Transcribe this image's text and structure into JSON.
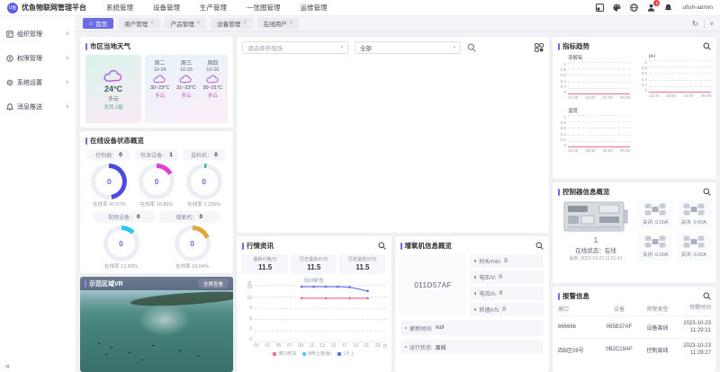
{
  "navbar": {
    "logo_text": "U鱼",
    "title": "优鱼物联网管理平台",
    "menu": [
      {
        "label": "系统管理"
      },
      {
        "label": "设备管理"
      },
      {
        "label": "生产管理"
      },
      {
        "label": "一张图管理"
      },
      {
        "label": "运维管理"
      }
    ],
    "badge_count": "6",
    "username": "ufish-admin"
  },
  "tabbar": {
    "tabs": [
      {
        "label": "首页"
      },
      {
        "label": "用户管理"
      },
      {
        "label": "产品管理"
      },
      {
        "label": "设备管理"
      },
      {
        "label": "在线用户"
      }
    ]
  },
  "sidebar": {
    "items": [
      {
        "label": "组织管理"
      },
      {
        "label": "权限管理"
      },
      {
        "label": "系统设置"
      },
      {
        "label": "消息推送"
      }
    ]
  },
  "glyphs": {
    "home": "⌂",
    "close": "×",
    "refresh": "↻",
    "chevron_down": "∨",
    "caret": "▾",
    "collapse": "«"
  },
  "weather": {
    "title": "市区当地天气",
    "current": {
      "temp": "24°C",
      "desc": "多云",
      "wind": "北风 1级"
    },
    "forecast": [
      {
        "day": "周二",
        "date": "10-24",
        "range": "30~23°C",
        "desc": "多云"
      },
      {
        "day": "周三",
        "date": "10-25",
        "range": "31~23°C",
        "desc": "多云"
      },
      {
        "day": "周四",
        "date": "10-26",
        "range": "30~21°C",
        "desc": "多云"
      }
    ]
  },
  "device_status": {
    "title": "在线设备状态概览",
    "counters": [
      {
        "label": "控制器：",
        "value": "0"
      },
      {
        "label": "检测设备：",
        "value": "1"
      },
      {
        "label": "投料机：",
        "value": "0"
      },
      {
        "label": "视频设备：",
        "value": "0"
      },
      {
        "label": "增氧机：",
        "value": "0"
      }
    ],
    "donuts": [
      {
        "value": "0",
        "rate_label": "在线率 47.37%",
        "pct": 47.37,
        "color": "#4b4be0"
      },
      {
        "value": "0",
        "rate_label": "在线率 16.85%",
        "pct": 16.85,
        "color": "#e03fd0"
      },
      {
        "value": "0",
        "rate_label": "在线率 2.239%",
        "pct": 2.24,
        "color": "#35b8a0"
      },
      {
        "value": "0",
        "rate_label": "在线率 12.83%",
        "pct": 12.83,
        "color": "#29c5f6"
      },
      {
        "value": "0",
        "rate_label": "在线率 19.04%",
        "pct": 19.04,
        "color": "#dfa83f"
      }
    ]
  },
  "vr": {
    "title": "示范区域VR",
    "button_label": "全屏查看"
  },
  "filter": {
    "farm_placeholder": "请选择养殖场",
    "scope_value": "全部"
  },
  "market": {
    "title": "行情资讯",
    "stats": [
      {
        "label": "最新价格/元",
        "value": "11.5"
      },
      {
        "label": "历史最高价/元",
        "value": "11.5"
      },
      {
        "label": "历史最低价/元",
        "value": "11.5"
      }
    ]
  },
  "aerator": {
    "title": "增氧机信息概览",
    "device_id": "011D57AF",
    "stats": [
      {
        "label": "时长/min:",
        "value": "0"
      },
      {
        "label": "电压/V:",
        "value": "0"
      },
      {
        "label": "电流/A:",
        "value": "0"
      },
      {
        "label": "转速/r/S:",
        "value": "0"
      }
    ],
    "update_label": "更新时间:",
    "update_value": "null",
    "status_label": "运行状态:",
    "status_value": "离线"
  },
  "trend": {
    "title": "指标趋势"
  },
  "controller": {
    "title": "控制器信息概览",
    "count": "1",
    "status_line": "在线状态：在线",
    "latest_line": "最新: 2023-10-23 11:51:41",
    "relays": [
      {
        "label": "关闭: 0.00A"
      },
      {
        "label": "关闭: 0.00A"
      },
      {
        "label": "关闭: 0.00A"
      },
      {
        "label": "关闭: 0.00A"
      }
    ]
  },
  "alarm": {
    "title": "报警信息",
    "headers": [
      "塘口",
      "设备",
      "预警类型",
      "预警时间"
    ],
    "rows": [
      {
        "pond": "666666",
        "device": "065B37AF",
        "type": "设备离线",
        "time1": "2023-10-23",
        "time2": "11:29:31"
      },
      {
        "pond": "四B区08号",
        "device": "0B2C19AF",
        "type": "控制离线",
        "time1": "2023-10-23",
        "time2": "11:29:27"
      }
    ]
  },
  "chart_data": [
    {
      "type": "line",
      "title": "加州鲈鱼",
      "ylabel": "元",
      "xlabel": "日",
      "ylim": [
        0,
        15
      ],
      "xrange": [
        1,
        23
      ],
      "grid": "dashed",
      "legend_position": "bottom",
      "yticks": [
        "15",
        "12",
        "9",
        "6",
        "3",
        "0"
      ],
      "xticks": [
        "01",
        "03",
        "05",
        "07",
        "09",
        "11",
        "13",
        "15",
        "17",
        "19",
        "21",
        "23"
      ],
      "series": [
        {
          "name": "塘口统货",
          "color": "#f0679c",
          "points": [
            [
              9,
              11.5
            ],
            [
              13,
              11.5
            ],
            [
              17,
              11.5
            ],
            [
              20,
              11.5
            ]
          ]
        },
        {
          "name": "8两上(新鱼)",
          "color": "#55c8f0",
          "points": []
        },
        {
          "name": "1斤上",
          "color": "#5b6de2",
          "points": [
            [
              9,
              14.5
            ],
            [
              11,
              14.5
            ],
            [
              13,
              14.5
            ],
            [
              15,
              14.5
            ],
            [
              17,
              14.4
            ],
            [
              20,
              13.4
            ]
          ]
        }
      ]
    },
    {
      "type": "line",
      "title": "溶解氧",
      "ylim": [
        0,
        1
      ],
      "grid": "dashed",
      "yticks": [
        "1",
        "0.8",
        "0.6",
        "0.4",
        "0.2",
        "0"
      ],
      "xticks": [
        "12:00",
        "19:00",
        "02:00",
        "09:00"
      ],
      "series": [
        {
          "name": "溶解氧",
          "color": "#f16a86",
          "values": [
            0,
            0,
            0,
            0
          ]
        }
      ]
    },
    {
      "type": "line",
      "title": "pH",
      "ylim": [
        0,
        1
      ],
      "grid": "dashed",
      "yticks": [
        "1",
        "0.8",
        "0.6",
        "0.4",
        "0.2",
        "0"
      ],
      "xticks": [
        "12:00",
        "19:00",
        "02:00",
        "09:00"
      ],
      "series": [
        {
          "name": "pH",
          "color": "#f16a86",
          "values": [
            0,
            0,
            0,
            0
          ]
        }
      ]
    },
    {
      "type": "line",
      "title": "温度",
      "ylim": [
        0,
        1
      ],
      "grid": "dashed",
      "yticks": [
        "1",
        "0.8",
        "0.6",
        "0.4",
        "0.2",
        "0"
      ],
      "xticks": [
        "12:00",
        "19:00",
        "02:00",
        "09:00"
      ],
      "series": [
        {
          "name": "温度",
          "color": "#f16a86",
          "values": [
            0,
            0,
            0,
            0
          ]
        }
      ]
    }
  ]
}
